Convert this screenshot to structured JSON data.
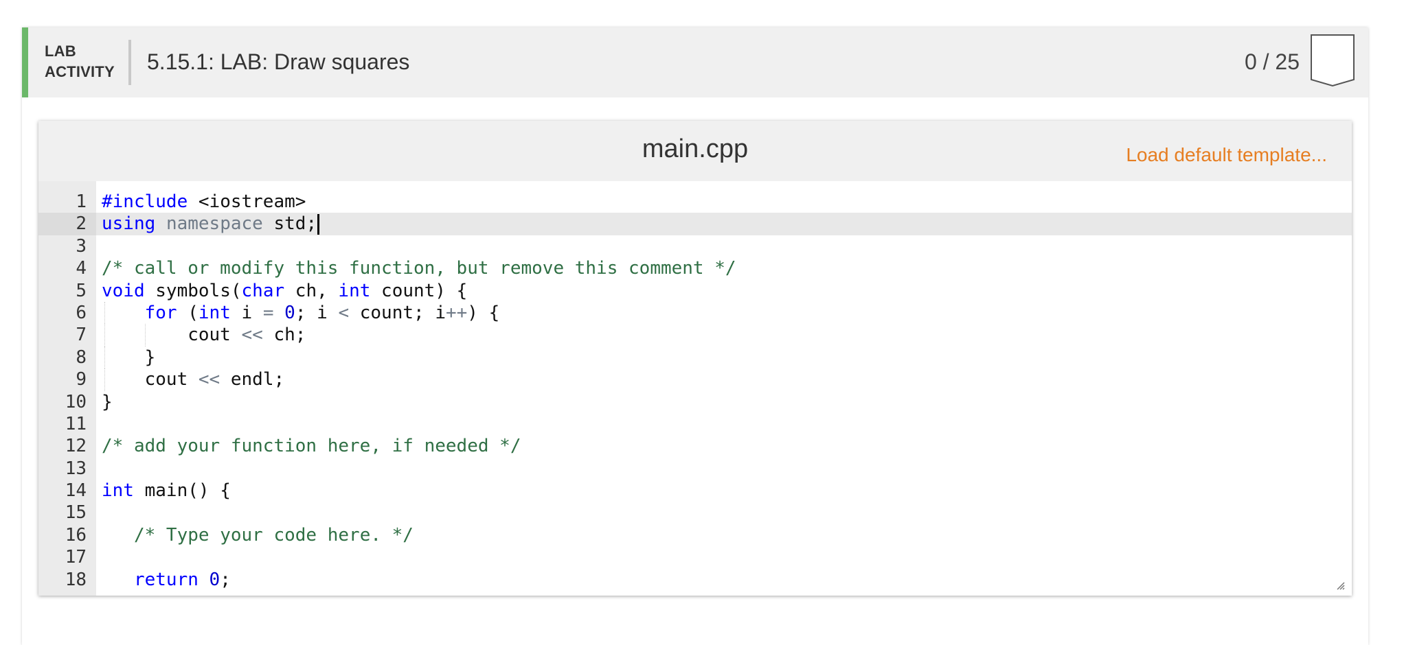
{
  "lab": {
    "type_line1": "LAB",
    "type_line2": "ACTIVITY",
    "title": "5.15.1: LAB: Draw squares",
    "score": "0 / 25"
  },
  "editor": {
    "filename": "main.cpp",
    "load_default": "Load default template...",
    "active_line": 2,
    "lines": [
      "#include <iostream>",
      "using namespace std;",
      "",
      "/* call or modify this function, but remove this comment */",
      "void symbols(char ch, int count) {",
      "    for (int i = 0; i < count; i++) {",
      "        cout << ch;",
      "    }",
      "    cout << endl;",
      "}",
      "",
      "/* add your function here, if needed */",
      "",
      "int main() {",
      "",
      "   /* Type your code here. */",
      "",
      "   return 0;"
    ]
  },
  "colors": {
    "accent_green": "#6cb86a",
    "link_orange": "#e67e22",
    "keyword_blue": "#0000ff",
    "comment_green": "#2f6f44"
  }
}
